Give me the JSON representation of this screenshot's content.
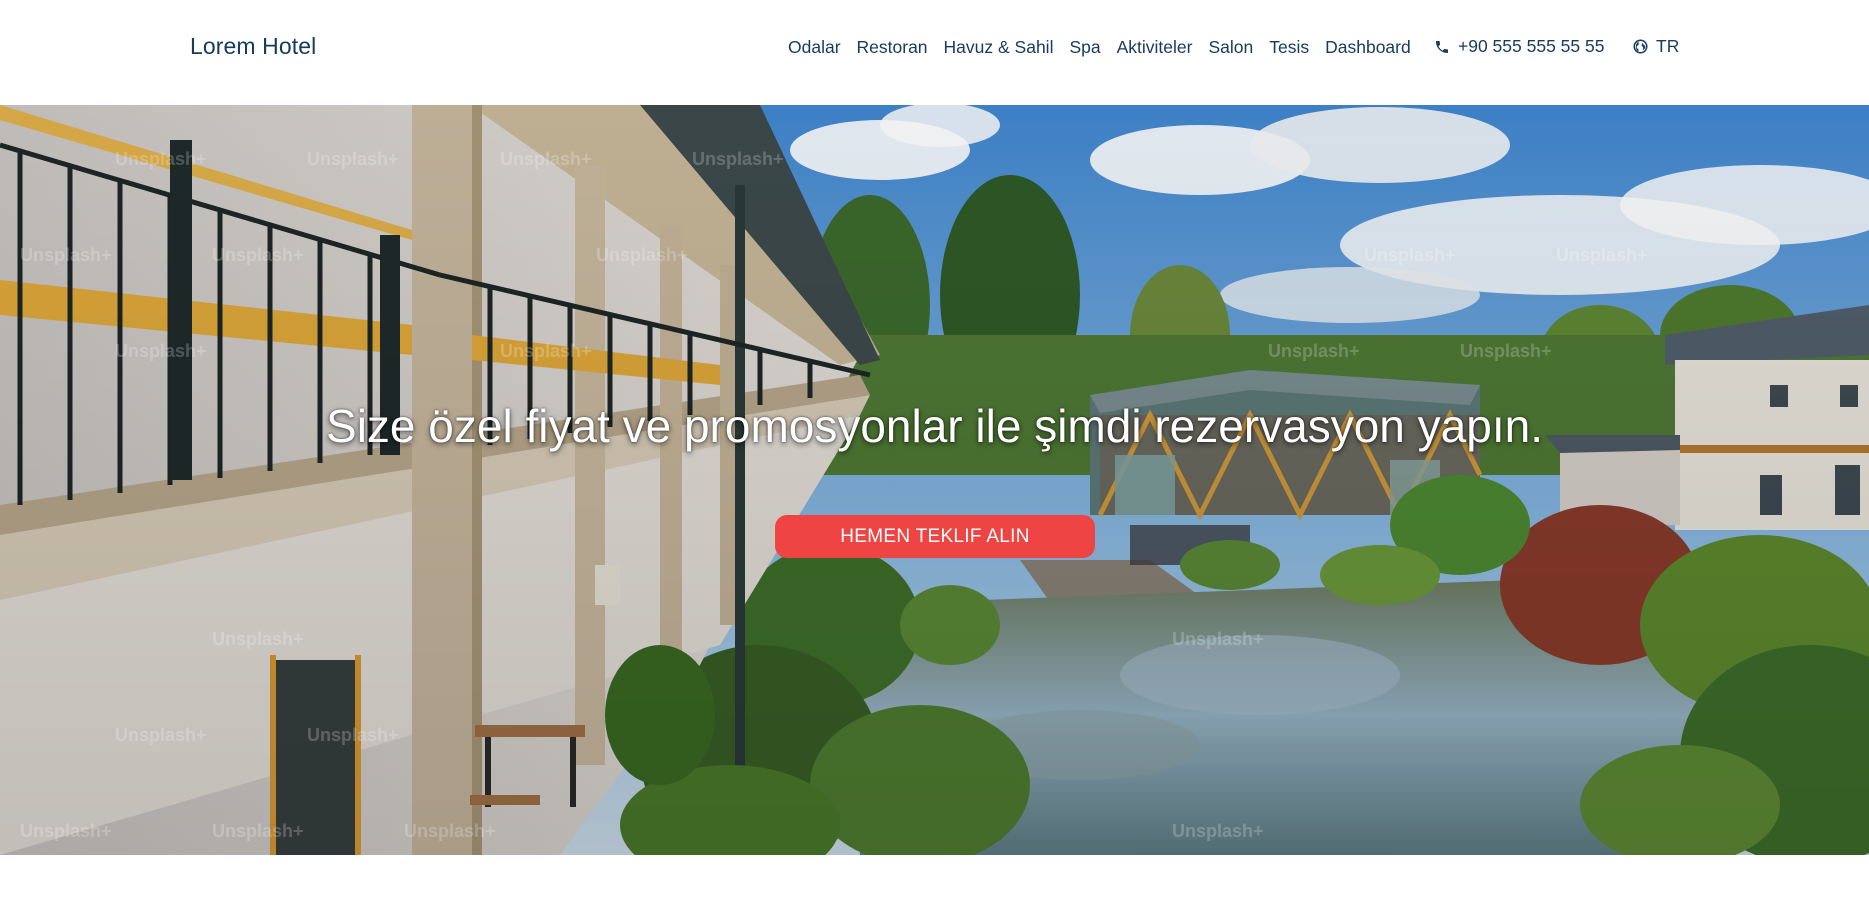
{
  "header": {
    "brand": "Lorem Hotel",
    "nav": [
      "Odalar",
      "Restoran",
      "Havuz & Sahil",
      "Spa",
      "Aktiviteler",
      "Salon",
      "Tesis",
      "Dashboard"
    ],
    "phone": "+90 555 555 55 55",
    "phone_icon": "phone-icon",
    "language": "TR",
    "language_icon": "globe-icon"
  },
  "hero": {
    "title": "Size özel fiyat ve promosyonlar ile şimdi rezervasyon yapın.",
    "cta_label": "HEMEN TEKLIF ALIN",
    "watermark": "Unsplash+"
  },
  "colors": {
    "brand_text": "#173a5e",
    "cta_background": "#ef4444",
    "page_background": "#ffffff"
  }
}
